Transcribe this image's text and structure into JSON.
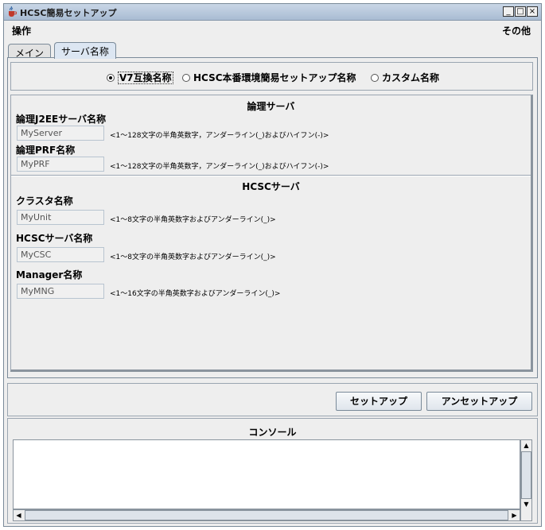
{
  "window": {
    "title": "HCSC簡易セットアップ",
    "controls": {
      "minimize": "_",
      "maximize": "□",
      "close": "×"
    }
  },
  "menubar": {
    "operation": "操作",
    "other": "その他"
  },
  "tabs": [
    {
      "label": "メイン",
      "selected": false
    },
    {
      "label": "サーバ名称",
      "selected": true
    }
  ],
  "naming_options": {
    "selected": "V7互換名称",
    "options": [
      "V7互換名称",
      "HCSC本番環境簡易セットアップ名称",
      "カスタム名称"
    ]
  },
  "logical_server": {
    "heading": "論理サーバ",
    "j2ee": {
      "label": "論理J2EEサーバ名称",
      "value": "MyServer",
      "hint": "<1～128文字の半角英数字，アンダーライン(_)およびハイフン(-)>"
    },
    "prf": {
      "label": "論理PRF名称",
      "value": "MyPRF",
      "hint": "<1～128文字の半角英数字，アンダーライン(_)およびハイフン(-)>"
    }
  },
  "hcsc_server": {
    "heading": "HCSCサーバ",
    "cluster": {
      "label": "クラスタ名称",
      "value": "MyUnit",
      "hint": "<1～8文字の半角英数字およびアンダーライン(_)>"
    },
    "server": {
      "label": "HCSCサーバ名称",
      "value": "MyCSC",
      "hint": "<1～8文字の半角英数字およびアンダーライン(_)>"
    },
    "manager": {
      "label": "Manager名称",
      "value": "MyMNG",
      "hint": "<1～16文字の半角英数字およびアンダーライン(_)>"
    }
  },
  "buttons": {
    "setup": "セットアップ",
    "unsetup": "アンセットアップ"
  },
  "console": {
    "title": "コンソール",
    "content": ""
  },
  "icons": {
    "app": "java-cup-icon",
    "scroll_up": "▲",
    "scroll_down": "▼",
    "scroll_left": "◀",
    "scroll_right": "▶"
  },
  "colors": {
    "titlebar": "#b9c9dc",
    "tab_selected": "#dce6f2",
    "frame": "#7a8a99"
  }
}
